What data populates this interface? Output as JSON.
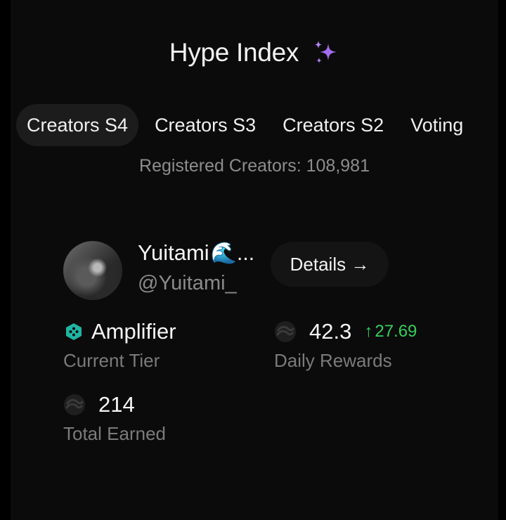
{
  "header": {
    "title": "Hype Index",
    "sparkle_icon": "sparkles-icon",
    "sparkle_color": "#a56cf0"
  },
  "tabs": [
    {
      "label": "Creators S4",
      "active": true
    },
    {
      "label": "Creators S3",
      "active": false
    },
    {
      "label": "Creators S2",
      "active": false
    },
    {
      "label": "Voting",
      "active": false
    }
  ],
  "registered": "Registered Creators: 108,981",
  "creator": {
    "name": "Yuitami",
    "name_emoji": "🌊...",
    "handle": "@Yuitami_",
    "details_label": "Details →"
  },
  "stats": {
    "tier": {
      "value": "Amplifier",
      "label": "Current Tier",
      "icon": "hexagon-tier-icon",
      "color": "#1fb5a3"
    },
    "daily": {
      "value": "42.3",
      "delta": "27.69",
      "delta_arrow": "↑",
      "label": "Daily Rewards",
      "delta_color": "#32d05a"
    },
    "total": {
      "value": "214",
      "label": "Total Earned"
    }
  }
}
